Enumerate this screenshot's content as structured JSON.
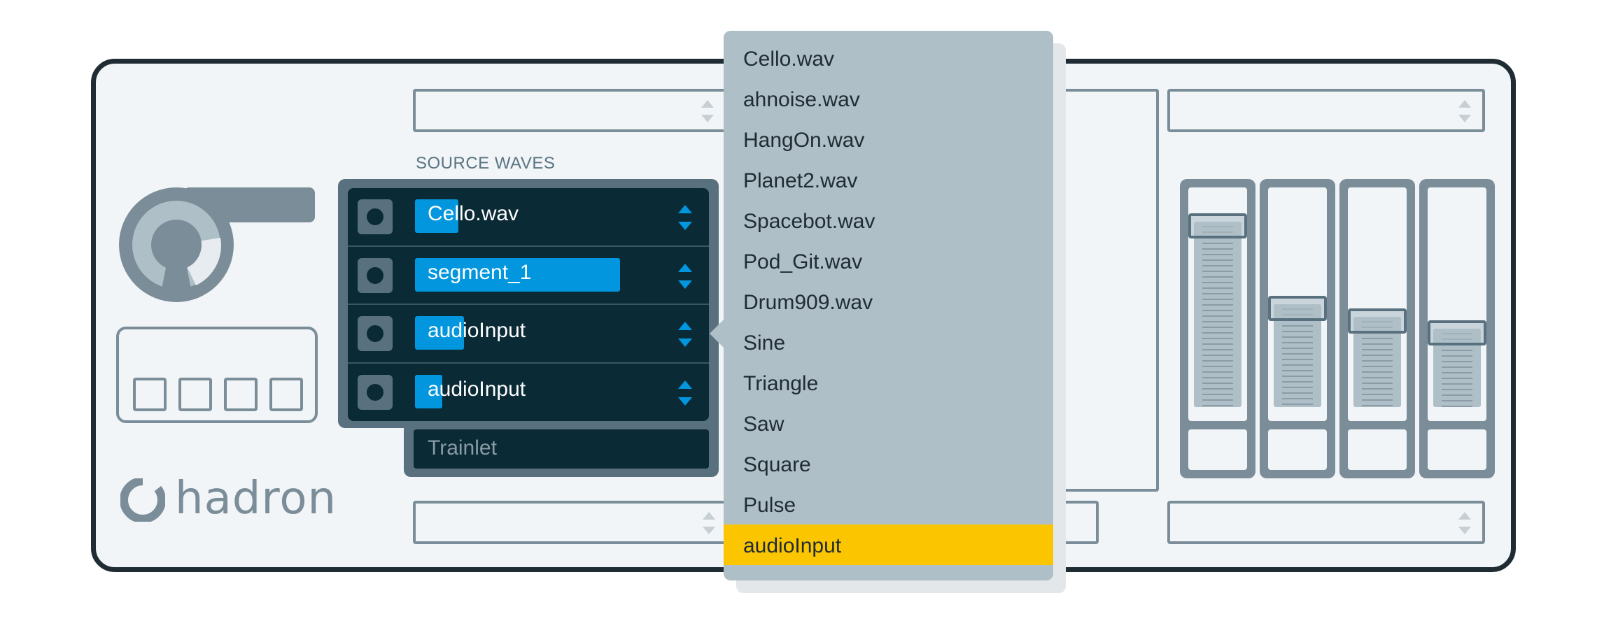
{
  "brand": {
    "name": "hadron"
  },
  "source_waves": {
    "label": "SOURCE WAVES",
    "rows": [
      {
        "label": "Cello.wav",
        "level": 0.16
      },
      {
        "label": "segment_1",
        "level": 0.75
      },
      {
        "label": "audioInput",
        "level": 0.18
      },
      {
        "label": "audioInput",
        "level": 0.1
      }
    ],
    "trainlet_placeholder": "Trainlet"
  },
  "dropdown": {
    "items": [
      "Cello.wav",
      "ahnoise.wav",
      "HangOn.wav",
      "Planet2.wav",
      "Spacebot.wav",
      "Pod_Git.wav",
      "Drum909.wav",
      "Sine",
      "Triangle",
      "Saw",
      "Square",
      "Pulse",
      "audioInput"
    ],
    "selected": "audioInput"
  },
  "faders": [
    {
      "level": 0.9
    },
    {
      "level": 0.5
    },
    {
      "level": 0.44
    },
    {
      "level": 0.38
    }
  ],
  "colors": {
    "accent_blue": "#0196dd",
    "selected_yellow": "#fbc500",
    "dark_panel": "#0a2a36",
    "slate": "#7a8d98"
  }
}
